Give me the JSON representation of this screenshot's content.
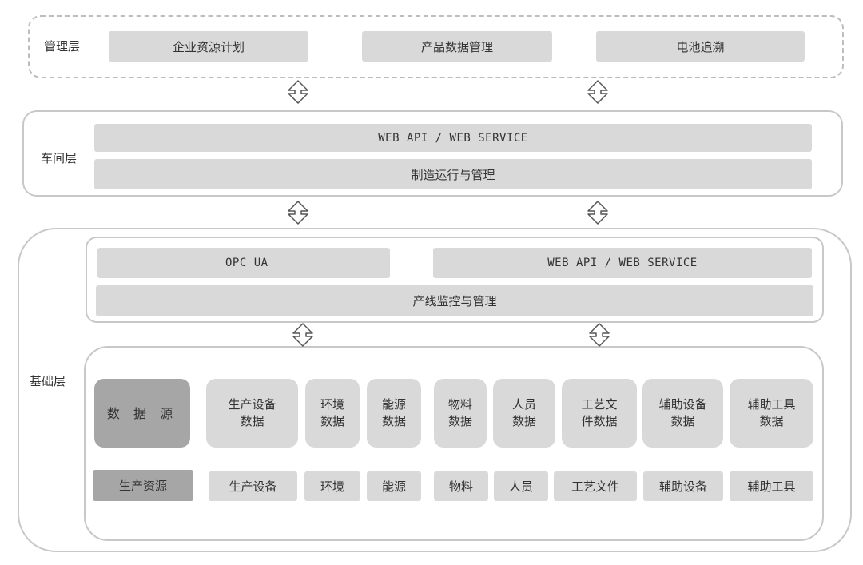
{
  "management": {
    "label": "管理层",
    "items": [
      "企业资源计划",
      "产品数据管理",
      "电池追溯"
    ]
  },
  "workshop": {
    "label": "车间层",
    "api": "WEB API / WEB SERVICE",
    "mom": "制造运行与管理"
  },
  "base": {
    "label": "基础层",
    "opc": "OPC UA",
    "api": "WEB API / WEB SERVICE",
    "line": "产线监控与管理",
    "data_source_label": "数 据 源",
    "data_items": [
      "生产设备\n数据",
      "环境\n数据",
      "能源\n数据",
      "物料\n数据",
      "人员\n数据",
      "工艺文\n件数据",
      "辅助设备\n数据",
      "辅助工具\n数据"
    ],
    "resource_label": "生产资源",
    "resource_items": [
      "生产设备",
      "环境",
      "能源",
      "物料",
      "人员",
      "工艺文件",
      "辅助设备",
      "辅助工具"
    ]
  }
}
